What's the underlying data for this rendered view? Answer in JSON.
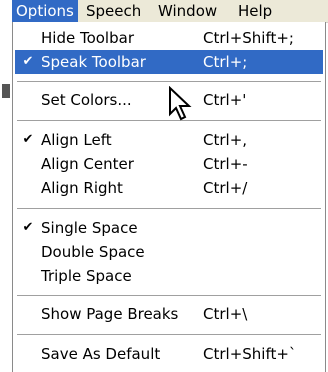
{
  "menubar": {
    "items": [
      {
        "label": "Options",
        "active": true
      },
      {
        "label": "Speech",
        "active": false
      },
      {
        "label": "Window",
        "active": false
      },
      {
        "label": "Help",
        "active": false
      }
    ]
  },
  "options_menu": {
    "items": [
      {
        "label": "Hide Toolbar",
        "shortcut": "Ctrl+Shift+;",
        "checked": false
      },
      {
        "label": "Speak Toolbar",
        "shortcut": "Ctrl+;",
        "checked": true,
        "highlighted": true
      },
      {
        "label": "Set Colors...",
        "shortcut": "Ctrl+'",
        "checked": false
      },
      {
        "label": "Align Left",
        "shortcut": "Ctrl+,",
        "checked": true
      },
      {
        "label": "Align Center",
        "shortcut": "Ctrl+-",
        "checked": false
      },
      {
        "label": "Align Right",
        "shortcut": "Ctrl+/",
        "checked": false
      },
      {
        "label": "Single Space",
        "shortcut": "",
        "checked": true
      },
      {
        "label": "Double Space",
        "shortcut": "",
        "checked": false
      },
      {
        "label": "Triple Space",
        "shortcut": "",
        "checked": false
      },
      {
        "label": "Show Page Breaks",
        "shortcut": "Ctrl+\\",
        "checked": false
      },
      {
        "label": "Save As Default",
        "shortcut": "Ctrl+Shift+`",
        "checked": false
      }
    ],
    "check_glyph": "✔"
  },
  "colors": {
    "highlight": "#316ac5",
    "menubar_bg": "#ece9d8"
  },
  "icons": [
    "checkmark-icon",
    "mouse-pointer-icon"
  ]
}
